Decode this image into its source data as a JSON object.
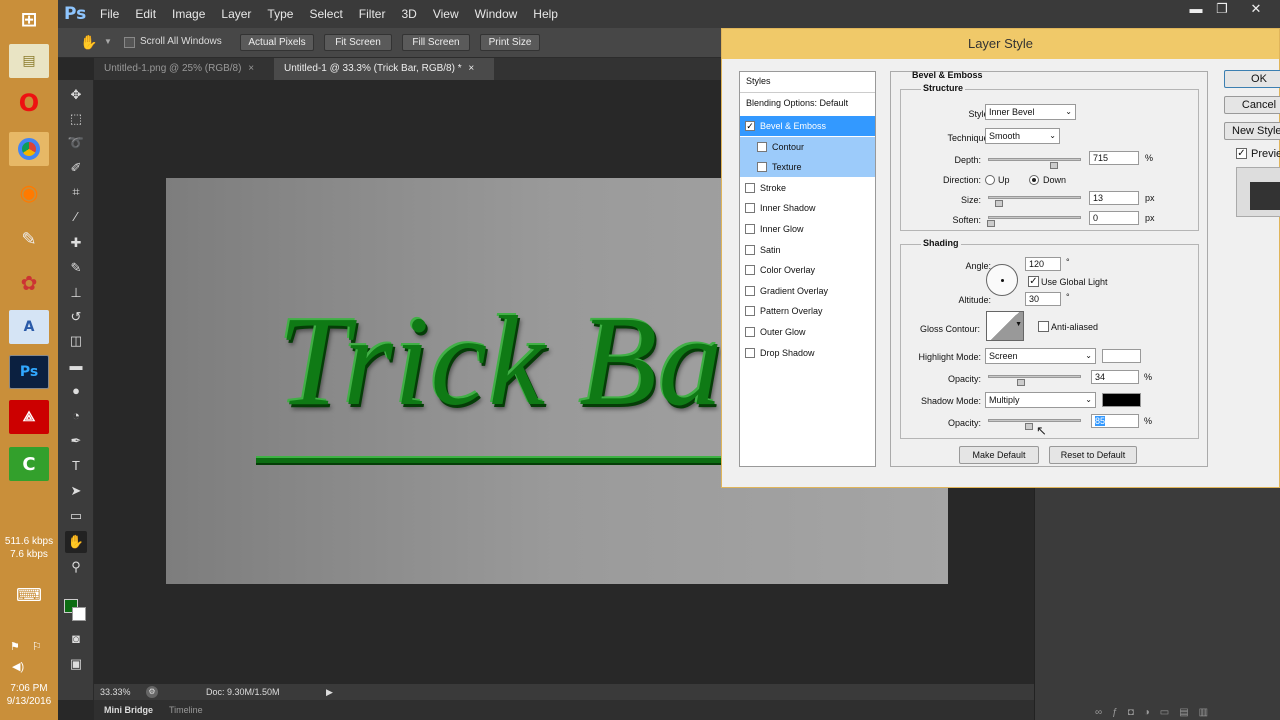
{
  "app": {
    "logo": "Ps"
  },
  "menu": [
    "File",
    "Edit",
    "Image",
    "Layer",
    "Type",
    "Select",
    "Filter",
    "3D",
    "View",
    "Window",
    "Help"
  ],
  "window_controls": {
    "minimize": "▬",
    "restore": "❐",
    "close": "✕"
  },
  "options_bar": {
    "scroll_all_windows": "Scroll All Windows",
    "actual_pixels": "Actual Pixels",
    "fit_screen": "Fit Screen",
    "fill_screen": "Fill Screen",
    "print_size": "Print Size"
  },
  "tabs": [
    {
      "label": "Untitled-1.png @ 25% (RGB/8)"
    },
    {
      "label": "Untitled-1 @ 33.3% (Trick Bar, RGB/8) *"
    }
  ],
  "tab_close": "×",
  "canvas": {
    "text": "Trick Ba"
  },
  "status": {
    "zoom": "33.33%",
    "doc": "Doc: 9.30M/1.50M"
  },
  "bottom_tabs": {
    "mini_bridge": "Mini Bridge",
    "timeline": "Timeline"
  },
  "taskbar": {
    "net_down": "511.6 kbps",
    "net_up": "7.6 kbps",
    "time": "7:06 PM",
    "date": "9/13/2016"
  },
  "dialog": {
    "title": "Layer Style",
    "styles_header": "Styles",
    "blending": "Blending Options: Default",
    "style_items": [
      {
        "label": "Bevel & Emboss",
        "checked": true
      },
      {
        "label": "Contour",
        "checked": false
      },
      {
        "label": "Texture",
        "checked": false
      },
      {
        "label": "Stroke",
        "checked": false
      },
      {
        "label": "Inner Shadow",
        "checked": false
      },
      {
        "label": "Inner Glow",
        "checked": false
      },
      {
        "label": "Satin",
        "checked": false
      },
      {
        "label": "Color Overlay",
        "checked": false
      },
      {
        "label": "Gradient Overlay",
        "checked": false
      },
      {
        "label": "Pattern Overlay",
        "checked": false
      },
      {
        "label": "Outer Glow",
        "checked": false
      },
      {
        "label": "Drop Shadow",
        "checked": false
      }
    ],
    "section_title": "Bevel & Emboss",
    "structure": {
      "title": "Structure",
      "style_label": "Style:",
      "style_value": "Inner Bevel",
      "technique_label": "Technique:",
      "technique_value": "Smooth",
      "depth_label": "Depth:",
      "depth_value": "715",
      "depth_unit": "%",
      "direction_label": "Direction:",
      "dir_up": "Up",
      "dir_down": "Down",
      "size_label": "Size:",
      "size_value": "13",
      "size_unit": "px",
      "soften_label": "Soften:",
      "soften_value": "0",
      "soften_unit": "px"
    },
    "shading": {
      "title": "Shading",
      "angle_label": "Angle:",
      "angle_value": "120",
      "deg": "°",
      "global_light": "Use Global Light",
      "altitude_label": "Altitude:",
      "altitude_value": "30",
      "gloss_label": "Gloss Contour:",
      "anti_aliased": "Anti-aliased",
      "highlight_label": "Highlight Mode:",
      "highlight_value": "Screen",
      "opacity_label": "Opacity:",
      "highlight_opacity": "34",
      "pct": "%",
      "shadow_label": "Shadow Mode:",
      "shadow_value": "Multiply",
      "shadow_opacity": "85"
    },
    "make_default": "Make Default",
    "reset_default": "Reset to Default",
    "ok": "OK",
    "cancel": "Cancel",
    "new_style": "New Style...",
    "preview": "Preview"
  }
}
